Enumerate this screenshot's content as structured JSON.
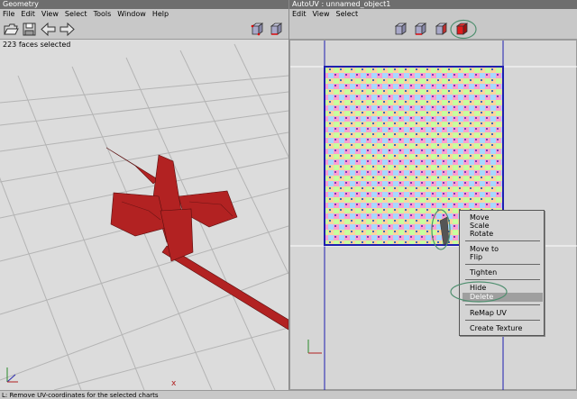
{
  "geometry_window": {
    "title": "Geometry",
    "menu": [
      "File",
      "Edit",
      "View",
      "Select",
      "Tools",
      "Window",
      "Help"
    ],
    "faces_selected": "223 faces selected",
    "axis_x_label": "x"
  },
  "autouv_window": {
    "title": "AutoUV : unnamed_object1",
    "menu": [
      "Edit",
      "View",
      "Select"
    ]
  },
  "context_menu": {
    "items": [
      "Move",
      "Scale",
      "Rotate",
      "Move to",
      "Flip",
      "Tighten",
      "Hide",
      "Delete",
      "ReMap UV",
      "Create Texture"
    ],
    "highlighted": "Delete"
  },
  "status_bar": {
    "text": "L: Remove UV-coordinates for the selected charts"
  },
  "colors": {
    "model_red": "#b22222",
    "uv_border": "#1f1fb0",
    "highlight_circle": "#4f8f6f"
  }
}
